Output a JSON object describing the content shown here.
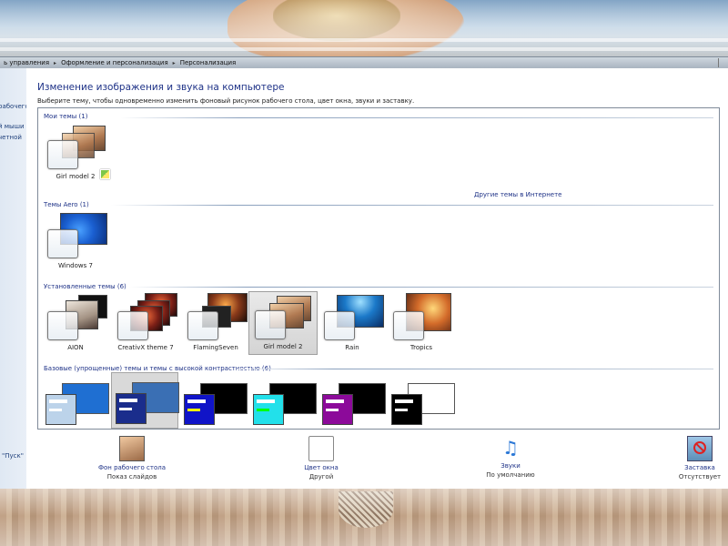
{
  "breadcrumb": [
    "ь управления",
    "Оформление и персонализация",
    "Персонализация"
  ],
  "nav_links": [
    "рабочего",
    "й мыши",
    "четной"
  ],
  "start_label": "\"Пуск\"",
  "page": {
    "title": "Изменение изображения и звука на компьютере",
    "description": "Выберите тему, чтобы одновременно изменить фоновый рисунок рабочего стола, цвет окна, звуки и заставку."
  },
  "groups": {
    "my": "Мои темы (1)",
    "aero": "Темы Aero (1)",
    "installed": "Установленные темы (6)",
    "basic": "Базовые (упрощенные) темы и темы с высокой контрастностью (6)"
  },
  "other_themes_link": "Другие темы в Интернете",
  "my_themes": [
    {
      "name": "Girl model 2"
    }
  ],
  "aero_themes": [
    {
      "name": "Windows 7"
    }
  ],
  "installed_themes": [
    {
      "name": "AION",
      "selected": false
    },
    {
      "name": "CreativX theme 7",
      "selected": false
    },
    {
      "name": "FlamingSeven",
      "selected": false
    },
    {
      "name": "Girl model 2",
      "selected": true
    },
    {
      "name": "Rain",
      "selected": false
    },
    {
      "name": "Tropics",
      "selected": false
    }
  ],
  "basic_themes_colors": {
    "t1": {
      "big": "#1f6fd2",
      "small": "#bcd3ea",
      "accent": "#ffffff"
    },
    "t2": {
      "big": "#3a6fb4",
      "small": "#1a2d8c",
      "accent": "#ffffff"
    },
    "t3": {
      "big": "#000000",
      "small": "#1014c8",
      "accent": "#ffff00"
    },
    "t4": {
      "big": "#000000",
      "small": "#22e0ea",
      "accent": "#00ff00"
    },
    "t5": {
      "big": "#000000",
      "small": "#8c0a9a",
      "accent": "#ffffff"
    },
    "t6": {
      "big": "#ffffff",
      "small": "#000000",
      "accent": "#ffffff"
    }
  },
  "bottom": {
    "desktop_bg": {
      "label": "Фон рабочего стола",
      "value": "Показ слайдов"
    },
    "window_color": {
      "label": "Цвет окна",
      "value": "Другой"
    },
    "sounds": {
      "label": "Звуки",
      "value": "По умолчанию"
    },
    "screensaver": {
      "label": "Заставка",
      "value": "Отсутствует"
    }
  }
}
